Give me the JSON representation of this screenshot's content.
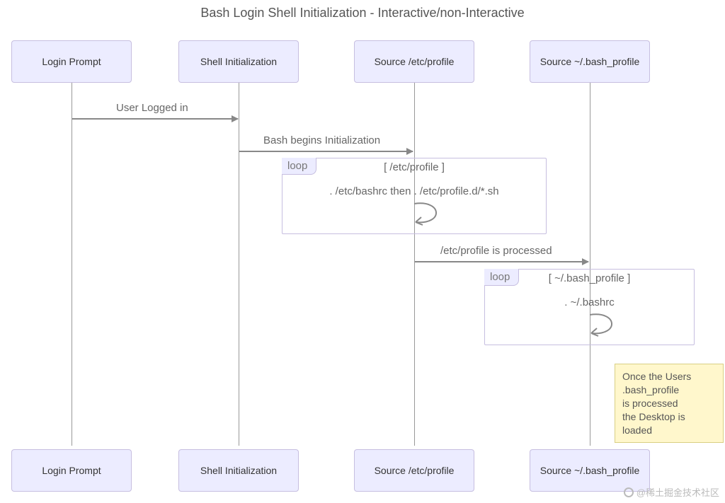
{
  "title": "Bash Login Shell Initialization - Interactive/non-Interactive",
  "actors": {
    "a1": "Login Prompt",
    "a2": "Shell Initialization",
    "a3": "Source /etc/profile",
    "a4": "Source ~/.bash_profile"
  },
  "messages": {
    "m1": "User Logged in",
    "m2": "Bash begins Initialization",
    "m3": "/etc/profile is processed"
  },
  "loops": {
    "l1": {
      "tag": "loop",
      "cond": "[ /etc/profile ]",
      "body": ". /etc/bashrc then . /etc/profile.d/*.sh"
    },
    "l2": {
      "tag": "loop",
      "cond": "[ ~/.bash_profile ]",
      "body": ". ~/.bashrc"
    }
  },
  "note": {
    "line1": "Once the Users",
    "line2": ".bash_profile",
    "line3": "is processed",
    "line4": "the Desktop is loaded"
  },
  "watermark": "@稀土掘金技术社区"
}
